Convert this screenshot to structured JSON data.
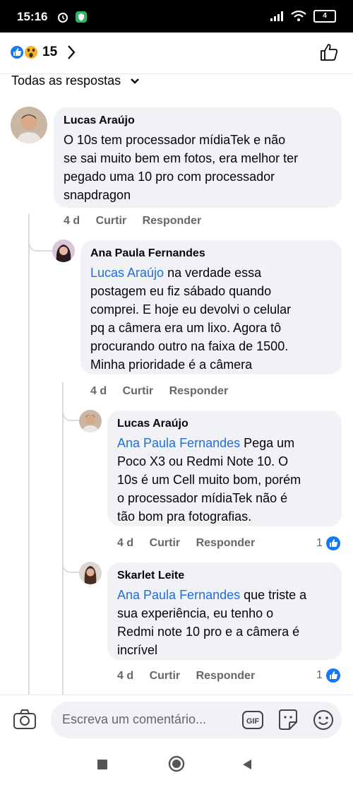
{
  "status_bar": {
    "time": "15:16",
    "battery": "4"
  },
  "header": {
    "reaction_count": "15"
  },
  "filter": {
    "label": "Todas as respostas"
  },
  "comments": [
    {
      "author": "Lucas Araújo",
      "text": "O 10s tem processador mídiaTek e não se sai muito bem em fotos, era melhor ter pegado uma 10 pro com processador snapdragon",
      "lines": [
        "O 10s tem processador mídiaTek e não",
        "se sai muito bem em fotos, era melhor ter",
        "pegado uma 10 pro com processador",
        "snapdragon"
      ],
      "time": "4 d",
      "like_label": "Curtir",
      "reply_label": "Responder"
    },
    {
      "author": "Ana Paula Fernandes",
      "mention": "Lucas Araújo",
      "text_first": " na verdade essa",
      "lines": [
        "postagem eu fiz sábado quando",
        "comprei. E hoje eu devolvi o celular",
        "pq a câmera era um lixo. Agora tô",
        "procurando outro na faixa de 1500.",
        "Minha prioridade é a câmera"
      ],
      "time": "4 d",
      "like_label": "Curtir",
      "reply_label": "Responder"
    },
    {
      "author": "Lucas Araújo",
      "mention": "Ana Paula Fernandes",
      "text_first": " Pega um",
      "lines": [
        "Poco X3 ou Redmi Note 10. O",
        "10s é um Cell muito bom, porém",
        "o processador mídiaTek não é",
        "tão bom pra fotografias."
      ],
      "time": "4 d",
      "like_label": "Curtir",
      "reply_label": "Responder",
      "like_count": "1"
    },
    {
      "author": "Skarlet Leite",
      "mention": "Ana Paula Fernandes",
      "text_first": " que triste a",
      "lines": [
        "sua experiência, eu tenho o",
        "Redmi note 10 pro e a câmera é",
        "incrível"
      ],
      "time": "4 d",
      "like_label": "Curtir",
      "reply_label": "Responder",
      "like_count": "1"
    }
  ],
  "composer": {
    "placeholder": "Escreva um comentário...",
    "gif_label": "GIF"
  },
  "colors": {
    "accent": "#216fdb",
    "bubble": "#f0f2f5",
    "meta": "#65676b"
  },
  "icons": [
    "like-reaction-icon",
    "wow-reaction-icon",
    "chevron-right-icon",
    "thumbs-up-outline-icon",
    "chevron-down-icon",
    "camera-icon",
    "gif-icon",
    "sticker-icon",
    "emoji-icon",
    "square-nav-icon",
    "circle-nav-icon",
    "back-triangle-icon"
  ]
}
